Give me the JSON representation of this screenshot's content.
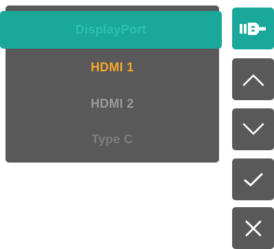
{
  "menu": {
    "items": [
      {
        "label": "DisplayPort",
        "state": "selected"
      },
      {
        "label": "HDMI 1",
        "state": "current"
      },
      {
        "label": "HDMI 2",
        "state": "normal"
      },
      {
        "label": "Type C",
        "state": "dim"
      }
    ]
  },
  "buttons": [
    {
      "icon": "input-source-icon",
      "state": "active"
    },
    {
      "icon": "chevron-up-icon",
      "state": "normal"
    },
    {
      "icon": "chevron-down-icon",
      "state": "normal"
    },
    {
      "icon": "checkmark-icon",
      "state": "normal"
    },
    {
      "icon": "close-icon",
      "state": "normal"
    }
  ],
  "colors": {
    "panel": "#595959",
    "accent": "#1aa89a",
    "selected_text": "#2bbfaf",
    "current_text": "#f4a82c",
    "normal_text": "#9a9a9a",
    "dim_text": "#7d7d7d",
    "icon": "#ffffff"
  }
}
